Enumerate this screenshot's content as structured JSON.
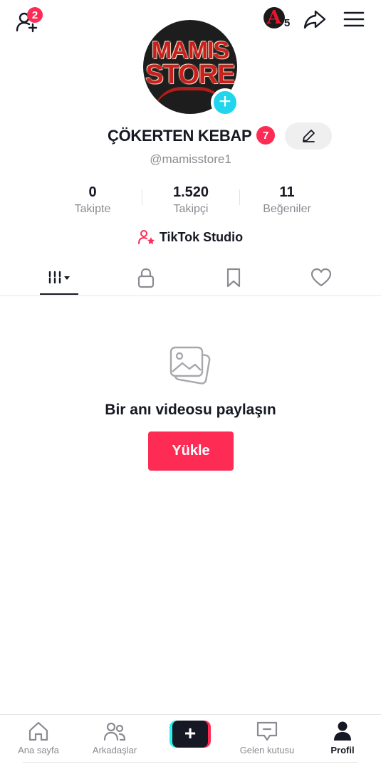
{
  "header": {
    "add_friend_badge": "2",
    "streak_letter": "A",
    "streak_count": "5"
  },
  "profile": {
    "avatar_text_line1": "MAMIS",
    "avatar_text_line2": "STORE",
    "display_name": "ÇÖKERTEN KEBAP",
    "name_badge": "7",
    "username": "@mamisstore1"
  },
  "stats": [
    {
      "value": "0",
      "label": "Takipte"
    },
    {
      "value": "1.520",
      "label": "Takipçi"
    },
    {
      "value": "11",
      "label": "Beğeniler"
    }
  ],
  "studio_label": "TikTok Studio",
  "empty_state": {
    "title": "Bir anı videosu paylaşın",
    "button": "Yükle"
  },
  "bottom_nav": [
    {
      "label": "Ana sayfa",
      "icon": "home-icon"
    },
    {
      "label": "Arkadaşlar",
      "icon": "friends-icon"
    },
    {
      "label": "",
      "icon": "create-plus-icon"
    },
    {
      "label": "Gelen kutusu",
      "icon": "inbox-icon"
    },
    {
      "label": "Profil",
      "icon": "profile-icon"
    }
  ],
  "colors": {
    "accent": "#fe2c55",
    "cyan": "#25f4ee",
    "text": "#161823",
    "muted": "#8a8b91"
  }
}
